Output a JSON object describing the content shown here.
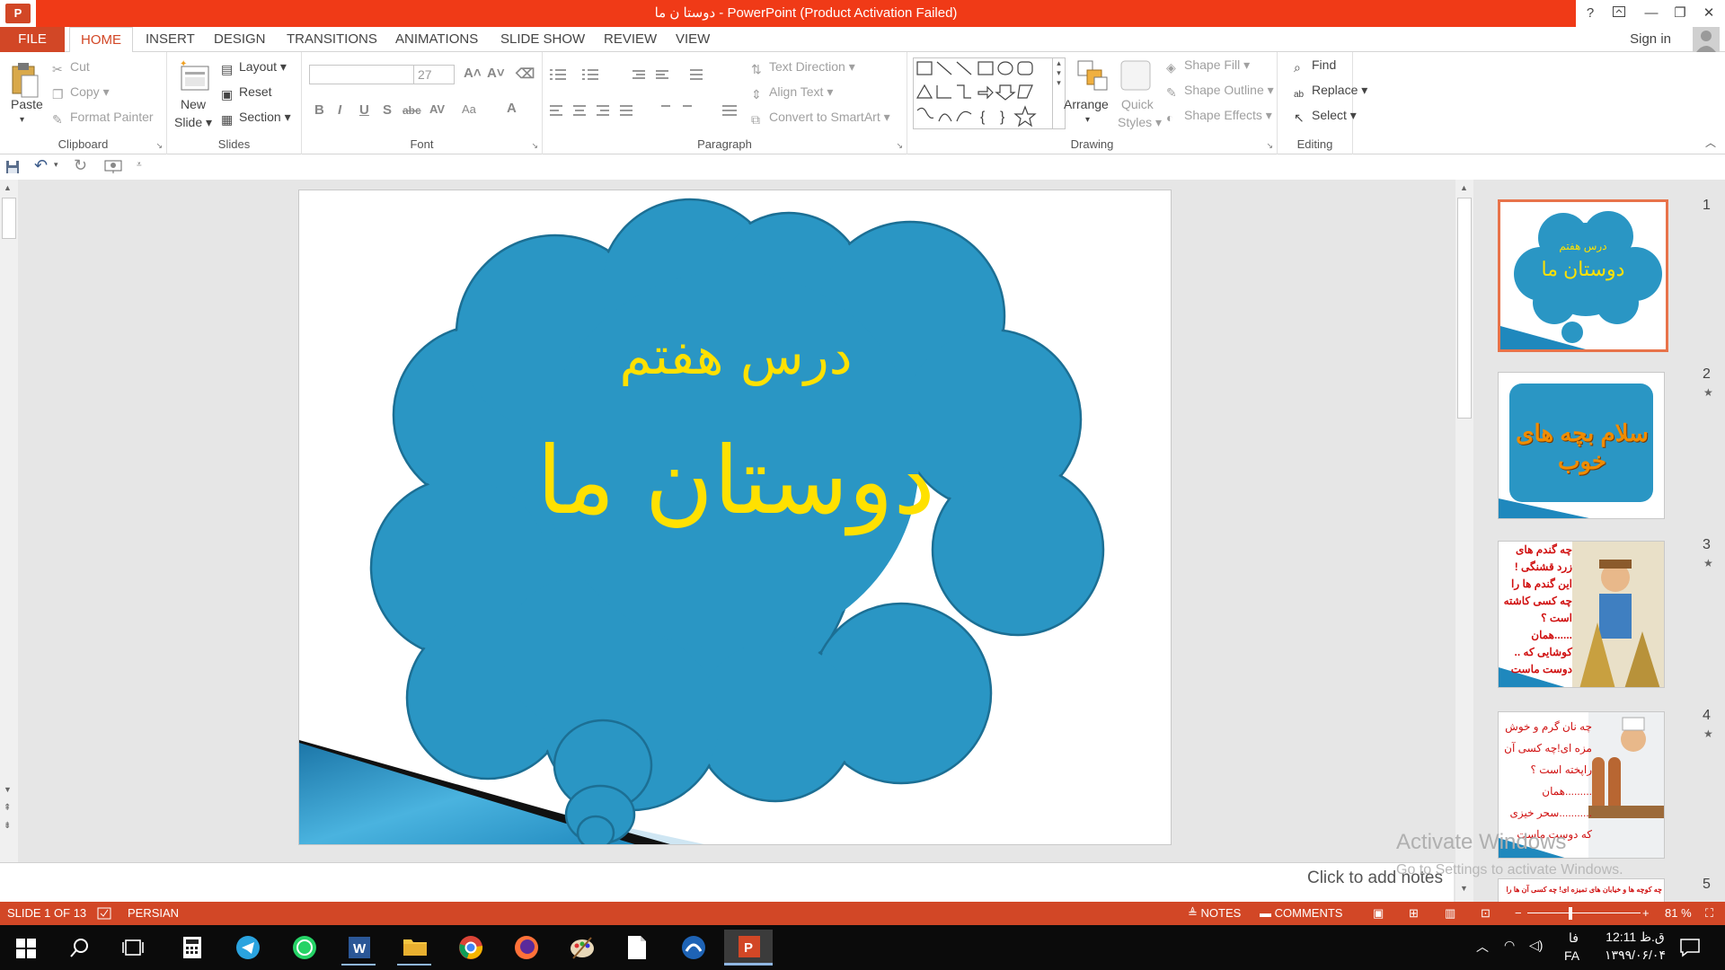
{
  "window": {
    "title": "دوستا ن ما  -  PowerPoint (Product Activation Failed)",
    "help": "?",
    "restore": "□",
    "minimize": "—",
    "maximize": "❐",
    "close": "✕"
  },
  "tabs": [
    "FILE",
    "HOME",
    "INSERT",
    "DESIGN",
    "TRANSITIONS",
    "ANIMATIONS",
    "SLIDE SHOW",
    "REVIEW",
    "VIEW"
  ],
  "active_tab": "HOME",
  "sign_in": "Sign in",
  "ribbon": {
    "clipboard": {
      "label": "Clipboard",
      "paste": "Paste",
      "cut": "Cut",
      "copy": "Copy",
      "format_painter": "Format Painter"
    },
    "slides": {
      "label": "Slides",
      "new_slide_1": "New",
      "new_slide_2": "Slide",
      "layout": "Layout",
      "reset": "Reset",
      "section": "Section"
    },
    "font": {
      "label": "Font",
      "font_name": "",
      "font_size": "27",
      "bold": "B",
      "italic": "I",
      "underline": "U",
      "shadow": "S",
      "strike": "abc",
      "spacing": "AV",
      "case": "Aa",
      "color": "A",
      "grow": "A˄",
      "shrink": "A˅"
    },
    "paragraph": {
      "label": "Paragraph",
      "text_direction": "Text Direction",
      "align_text": "Align Text",
      "convert_smartart": "Convert to SmartArt"
    },
    "drawing": {
      "label": "Drawing",
      "arrange": "Arrange",
      "quick_styles_1": "Quick",
      "quick_styles_2": "Styles",
      "shape_fill": "Shape Fill",
      "shape_outline": "Shape Outline",
      "shape_effects": "Shape Effects"
    },
    "editing": {
      "label": "Editing",
      "find": "Find",
      "replace": "Replace",
      "select": "Select"
    }
  },
  "slide": {
    "subtitle": "درس هفتم",
    "title": "دوستان ما",
    "bubble_color": "#2a96c4",
    "text_color": "#ffe100"
  },
  "thumbnails": [
    {
      "num": "1",
      "subtitle": "درس هفتم",
      "title": "دوستان ما"
    },
    {
      "num": "2",
      "star": "★",
      "text": "سلام بچه های خوب"
    },
    {
      "num": "3",
      "star": "★",
      "lines": [
        "چه گندم های",
        "زرد قشنگی !",
        "این گندم ها را",
        "چه کسی کاشته",
        "است ؟",
        "......همان",
        "کوشایی که ..",
        "دوست ماست"
      ]
    },
    {
      "num": "4",
      "star": "★",
      "lines": [
        "چه نان گرم و خوش",
        "مزه ای!چه کسی آن",
        "راپخته است ؟",
        ".........همان",
        "...........سحر خیزی",
        "که دوست ماست"
      ]
    },
    {
      "num": "5",
      "line": "چه کوچه ها و خیابان های تمیزه ای! چه کسی آن ها را"
    }
  ],
  "notes_placeholder": "Click to add notes",
  "activation": {
    "line1": "Activate Windows",
    "line2": "Go to Settings to activate Windows."
  },
  "status": {
    "slide_of": "SLIDE 1 OF 13",
    "language": "PERSIAN",
    "notes": "NOTES",
    "comments": "COMMENTS",
    "zoom": "81 %"
  },
  "taskbar": {
    "time": "12:11 ق.ظ",
    "date": "۱۳۹۹/۰۶/۰۴",
    "lang": "FA",
    "lang2": "فا"
  }
}
